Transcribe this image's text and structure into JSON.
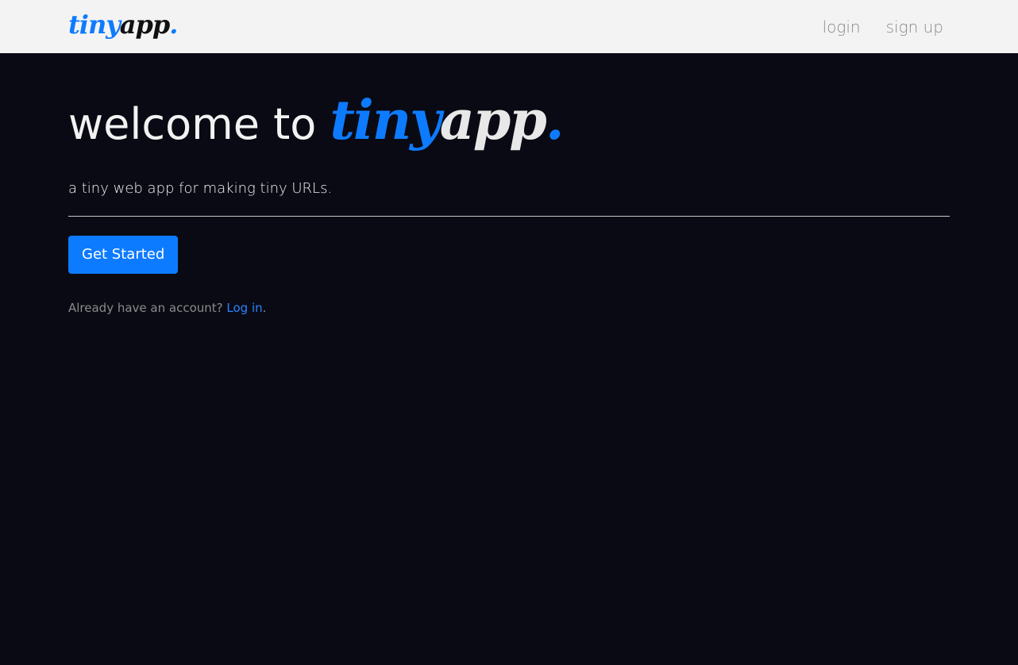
{
  "navbar": {
    "brand": {
      "part1": "tiny",
      "part2": "app",
      "part3": "."
    },
    "links": {
      "login": "login",
      "signup": "sign up"
    }
  },
  "hero": {
    "title_prefix": "welcome to ",
    "logo": {
      "part1": "tiny",
      "part2": "app",
      "part3": "."
    },
    "lead": "a tiny web app for making tiny URLs.",
    "cta_label": "Get Started",
    "account_prompt": "Already have an account? ",
    "login_link": "Log in",
    "trailing_period": "."
  },
  "colors": {
    "background": "#0a0a14",
    "navbar": "#f3f3f3",
    "accent": "#0d7bff",
    "muted_text": "#8a8a8a"
  }
}
